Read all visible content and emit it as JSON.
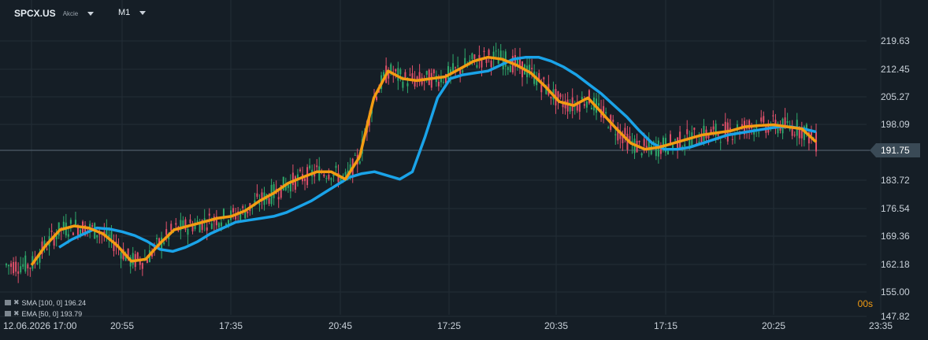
{
  "header": {
    "symbol": "SPCX.US",
    "symbol_type": "Akcie",
    "timeframe": "M1"
  },
  "price_tag": "191.75",
  "countdown": "00s",
  "legend": [
    {
      "label": "SMA [100, 0] 196.24",
      "color": "#1aa3e8"
    },
    {
      "label": "EMA [50, 0] 193.79",
      "color": "#f39c12"
    }
  ],
  "colors": {
    "background": "#151e26",
    "sma": "#1aa3e8",
    "ema": "#f39c12",
    "up": "#2ea86b",
    "down": "#e0506a",
    "price_line": "#5a6b78"
  },
  "chart_data": {
    "type": "line",
    "y_ticks": [
      "219.63",
      "212.45",
      "205.27",
      "198.09",
      "191.75",
      "183.72",
      "176.54",
      "169.36",
      "162.18",
      "155.00",
      "147.82"
    ],
    "x_ticks": [
      "12.06.2026 17:00",
      "20:55",
      "17:35",
      "20:45",
      "17:25",
      "20:35",
      "17:15",
      "20:25",
      "23:35"
    ],
    "ylim": [
      147.82,
      219.63
    ],
    "current_price": 191.75,
    "series": [
      {
        "name": "SMA [100, 0]",
        "last": 196.24,
        "values": [
          166.5,
          168.5,
          170.0,
          171.5,
          171.2,
          170.5,
          169.5,
          168.0,
          166.0,
          165.5,
          166.5,
          168.0,
          170.0,
          171.5,
          173.0,
          173.5,
          174.0,
          174.5,
          175.5,
          177.0,
          178.5,
          180.5,
          182.5,
          184.5,
          185.5,
          186.0,
          185.0,
          184.0,
          186.0,
          195.0,
          205.0,
          210.0,
          211.0,
          211.5,
          212.0,
          213.5,
          215.0,
          215.5,
          215.5,
          214.5,
          213.0,
          211.0,
          208.5,
          206.0,
          203.0,
          200.0,
          196.5,
          193.5,
          192.0,
          192.0,
          192.5,
          193.5,
          194.5,
          195.5,
          196.0,
          196.5,
          197.0,
          197.5,
          197.5,
          197.0,
          196.24
        ]
      },
      {
        "name": "EMA [50, 0]",
        "last": 193.79,
        "values": [
          162.0,
          167.0,
          171.0,
          172.0,
          171.5,
          170.0,
          167.0,
          163.0,
          163.5,
          167.5,
          171.0,
          172.0,
          173.0,
          174.0,
          174.5,
          176.0,
          178.5,
          180.5,
          183.0,
          184.5,
          186.0,
          186.0,
          184.0,
          190.0,
          205.0,
          212.0,
          210.0,
          209.5,
          210.0,
          210.5,
          212.5,
          214.5,
          215.5,
          215.0,
          213.5,
          211.5,
          208.0,
          204.0,
          203.0,
          205.0,
          201.0,
          197.0,
          193.5,
          192.0,
          192.5,
          193.5,
          194.5,
          195.5,
          196.0,
          196.5,
          197.5,
          197.8,
          198.0,
          197.5,
          197.0,
          193.79
        ]
      }
    ]
  }
}
